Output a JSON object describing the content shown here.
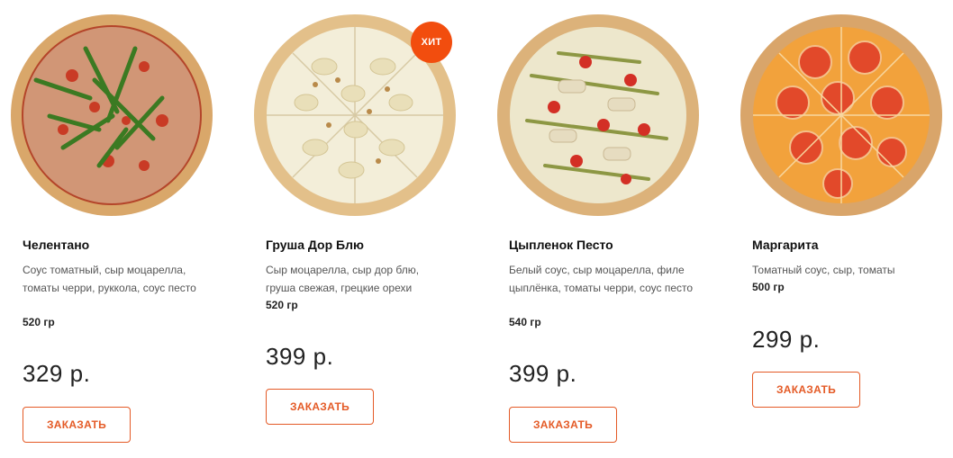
{
  "products": [
    {
      "name": "Челентано",
      "description": "Соус томатный, сыр моцарелла, томаты черри, руккола, соус песто",
      "weight": "520 гр",
      "price": "329 р.",
      "button_label": "ЗАКАЗАТЬ",
      "image": "pizza-arugula-icon"
    },
    {
      "name": "Груша Дор Блю",
      "description": "Сыр моцарелла, сыр дор блю, груша свежая, грецкие орехи",
      "weight": "520 гр",
      "price": "399 р.",
      "button_label": "ЗАКАЗАТЬ",
      "badge": "ХИТ",
      "image": "pizza-pear-icon"
    },
    {
      "name": "Цыпленок Песто",
      "description": "Белый соус, сыр моцарелла, филе цыплёнка, томаты черри, соус песто",
      "weight": "540 гр",
      "price": "399 р.",
      "button_label": "ЗАКАЗАТЬ",
      "image": "pizza-chicken-pesto-icon"
    },
    {
      "name": "Маргарита",
      "description": "Томатный соус, сыр, томаты",
      "weight": "500 гр",
      "price": "299 р.",
      "button_label": "ЗАКАЗАТЬ",
      "image": "pizza-margherita-icon"
    }
  ],
  "colors": {
    "accent": "#e45a26",
    "badge": "#f24d0e",
    "crust": "#d9a76a"
  }
}
